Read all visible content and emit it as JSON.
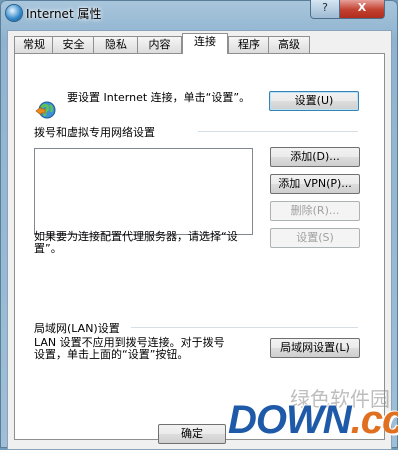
{
  "window": {
    "title": "Internet 属性",
    "help_label": "?",
    "close_label": "X"
  },
  "tabs": [
    {
      "label": "常规"
    },
    {
      "label": "安全"
    },
    {
      "label": "隐私"
    },
    {
      "label": "内容"
    },
    {
      "label": "连接"
    },
    {
      "label": "程序"
    },
    {
      "label": "高级"
    }
  ],
  "active_tab": "连接",
  "connections": {
    "setup_text": "要设置 Internet 连接，单击“设置”。",
    "setup_button": "设置(U)",
    "dialup_group_title": "拨号和虚拟专用网络设置",
    "add_button": "添加(D)...",
    "add_vpn_button": "添加 VPN(P)...",
    "delete_button": "删除(R)...",
    "proxy_text": "如果要为连接配置代理服务器，请选择“设置”。",
    "settings_button": "设置(S)",
    "lan_group_title": "局域网(LAN)设置",
    "lan_text": "LAN 设置不应用到拨号连接。对于拨号设置，单击上面的“设置”按钮。",
    "lan_button": "局域网设置(L)"
  },
  "footer": {
    "ok_button": "确定"
  },
  "watermark": {
    "brand": "DOWN",
    "suffix": ".cc",
    "faded_text": "绿色软件园"
  }
}
